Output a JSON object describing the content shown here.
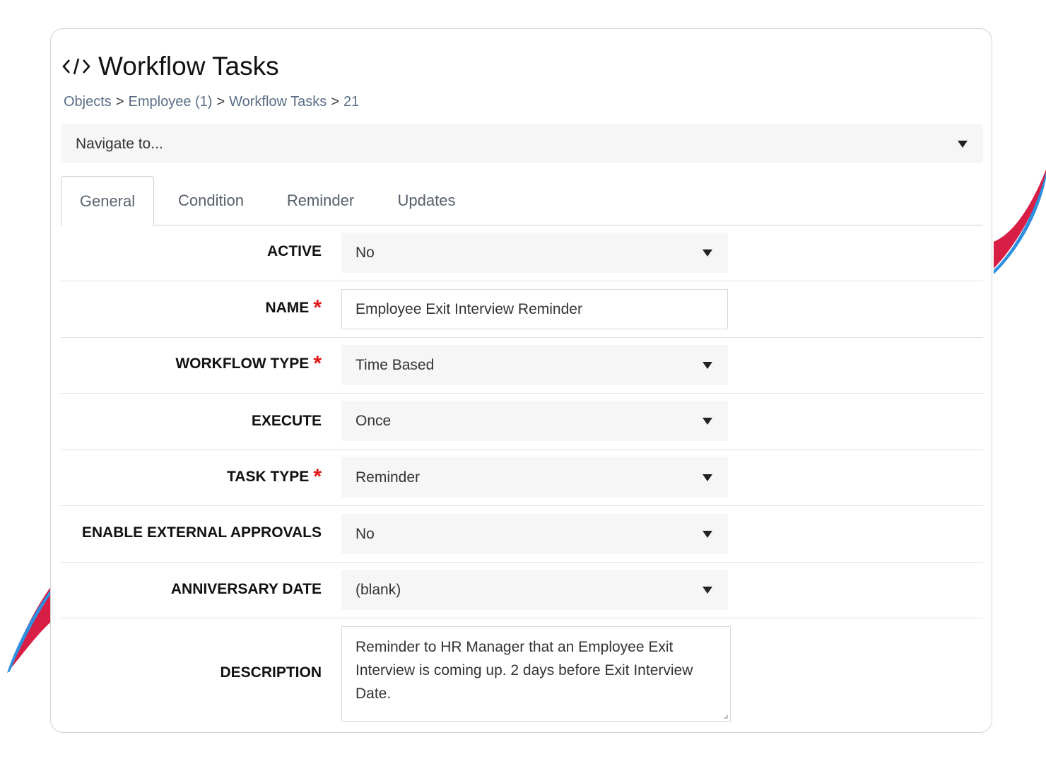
{
  "header": {
    "icon": "code-icon",
    "title": "Workflow Tasks"
  },
  "breadcrumb": {
    "items": [
      "Objects",
      "Employee (1)",
      "Workflow Tasks"
    ],
    "separator": ">",
    "current": "21"
  },
  "navigate": {
    "placeholder": "Navigate to..."
  },
  "tabs": [
    {
      "label": "General",
      "active": true
    },
    {
      "label": "Condition",
      "active": false
    },
    {
      "label": "Reminder",
      "active": false
    },
    {
      "label": "Updates",
      "active": false
    }
  ],
  "form": {
    "required_marker": "*",
    "active": {
      "label": "ACTIVE",
      "value": "No"
    },
    "name": {
      "label": "NAME",
      "value": "Employee Exit Interview Reminder"
    },
    "workflow_type": {
      "label": "WORKFLOW TYPE",
      "value": "Time Based"
    },
    "execute": {
      "label": "EXECUTE",
      "value": "Once"
    },
    "task_type": {
      "label": "TASK TYPE",
      "value": "Reminder"
    },
    "external_approvals": {
      "label": "ENABLE EXTERNAL APPROVALS",
      "value": "No"
    },
    "anniversary_date": {
      "label": "ANNIVERSARY DATE",
      "value": "(blank)"
    },
    "description": {
      "label": "DESCRIPTION",
      "value": "Reminder to HR Manager that an Employee Exit Interview is coming up. 2 days before Exit Interview Date."
    }
  },
  "colors": {
    "accent_red": "#e01b1b",
    "decor_red": "#d91e46",
    "decor_blue": "#2c8fe0",
    "link": "#5a6d86"
  }
}
